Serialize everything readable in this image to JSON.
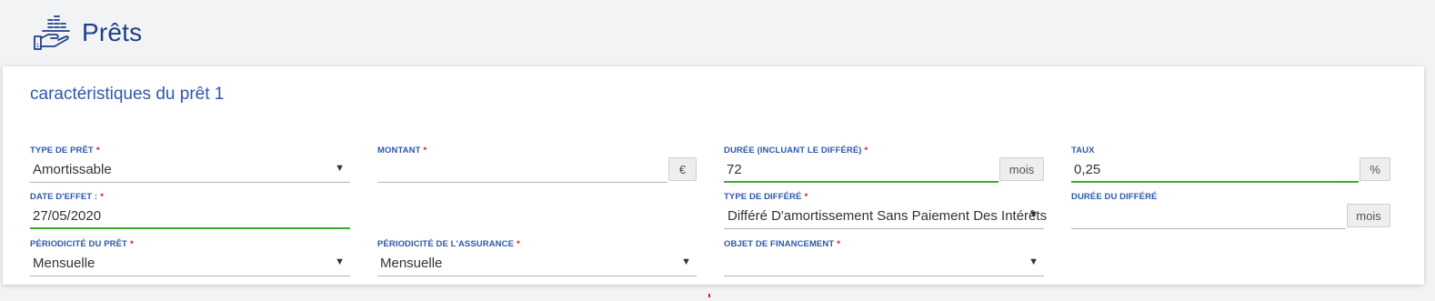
{
  "page": {
    "title": "Prêts",
    "icon": "loan-hand-coins-icon"
  },
  "card": {
    "title": "caractéristiques du prêt 1"
  },
  "required_marker": "*",
  "fields": {
    "type_pret": {
      "label": "TYPE DE PRÊT",
      "value": "Amortissable",
      "required": true
    },
    "montant": {
      "label": "MONTANT",
      "value": "",
      "addon": "€",
      "required": true
    },
    "duree": {
      "label": "DURÉE (INCLUANT LE DIFFÉRÉ)",
      "value": "72",
      "addon": "mois",
      "required": true
    },
    "taux": {
      "label": "TAUX",
      "value": "0,25",
      "addon": "%",
      "required": false
    },
    "date_effet": {
      "label": "DATE D'EFFET :",
      "value": "27/05/2020",
      "required": true
    },
    "type_differe": {
      "label": "TYPE DE DIFFÉRÉ",
      "value": "Différé D'amortissement Sans Paiement Des Intérêts",
      "required": true
    },
    "duree_differe": {
      "label": "DURÉE DU DIFFÉRÉ",
      "value": "",
      "addon": "mois",
      "required": false
    },
    "periodicite_pret": {
      "label": "PÉRIODICITÉ DU PRÊT",
      "value": "Mensuelle",
      "required": true
    },
    "periodicite_assurance": {
      "label": "PÉRIODICITÉ DE L'ASSURANCE",
      "value": "Mensuelle",
      "required": true
    },
    "objet_financement": {
      "label": "OBJET DE FINANCEMENT",
      "value": "",
      "required": true
    }
  },
  "colors": {
    "title_blue": "#1e3f8a",
    "label_blue": "#2d59a8",
    "required_red": "#e0132b",
    "focus_green": "#3eaa34"
  }
}
